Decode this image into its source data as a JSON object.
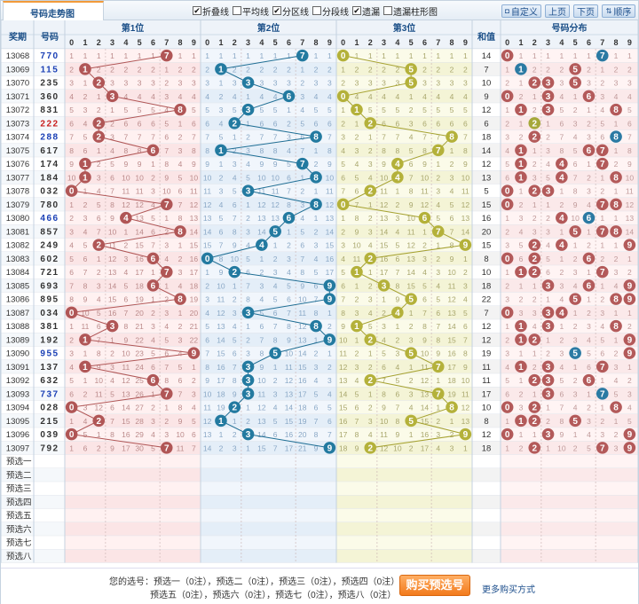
{
  "header": {
    "tab_title": "号码走势图",
    "options": [
      {
        "label": "折叠线",
        "checked": true
      },
      {
        "label": "平均线",
        "checked": false
      },
      {
        "label": "分区线",
        "checked": true
      },
      {
        "label": "分段线",
        "checked": false
      },
      {
        "label": "遗漏",
        "checked": true
      },
      {
        "label": "遗漏柱形图",
        "checked": false
      }
    ],
    "buttons": {
      "custom": "自定义",
      "prev": "上页",
      "next": "下页",
      "order": "顺序"
    }
  },
  "columns": {
    "period": "奖期",
    "number": "号码",
    "pos1": "第1位",
    "pos2": "第2位",
    "pos3": "第3位",
    "sum": "和值",
    "dist": "号码分布",
    "digits": [
      "0",
      "1",
      "2",
      "3",
      "4",
      "5",
      "6",
      "7",
      "8",
      "9"
    ]
  },
  "rows": [
    {
      "period": "13068",
      "number": "770",
      "digits": [
        7,
        7,
        0
      ],
      "sum": "14"
    },
    {
      "period": "13069",
      "number": "115",
      "digits": [
        1,
        1,
        5
      ],
      "sum": "7"
    },
    {
      "period": "13070",
      "number": "235",
      "digits": [
        2,
        3,
        5
      ],
      "sum": "10"
    },
    {
      "period": "13071",
      "number": "360",
      "digits": [
        3,
        6,
        0
      ],
      "sum": "9"
    },
    {
      "period": "13072",
      "number": "831",
      "digits": [
        8,
        3,
        1
      ],
      "sum": "12"
    },
    {
      "period": "13073",
      "number": "222",
      "digits": [
        2,
        2,
        2
      ],
      "sum": "6"
    },
    {
      "period": "13074",
      "number": "288",
      "digits": [
        2,
        8,
        8
      ],
      "sum": "18"
    },
    {
      "period": "13075",
      "number": "617",
      "digits": [
        6,
        1,
        7
      ],
      "sum": "14"
    },
    {
      "period": "13076",
      "number": "174",
      "digits": [
        1,
        7,
        4
      ],
      "sum": "12"
    },
    {
      "period": "13077",
      "number": "184",
      "digits": [
        1,
        8,
        4
      ],
      "sum": "13"
    },
    {
      "period": "13078",
      "number": "032",
      "digits": [
        0,
        3,
        2
      ],
      "sum": "5"
    },
    {
      "period": "13079",
      "number": "780",
      "digits": [
        7,
        8,
        0
      ],
      "sum": "15"
    },
    {
      "period": "13080",
      "number": "466",
      "digits": [
        4,
        6,
        6
      ],
      "sum": "16"
    },
    {
      "period": "13081",
      "number": "857",
      "digits": [
        8,
        5,
        7
      ],
      "sum": "20"
    },
    {
      "period": "13082",
      "number": "249",
      "digits": [
        2,
        4,
        9
      ],
      "sum": "15"
    },
    {
      "period": "13083",
      "number": "602",
      "digits": [
        6,
        0,
        2
      ],
      "sum": "8"
    },
    {
      "period": "13084",
      "number": "721",
      "digits": [
        7,
        2,
        1
      ],
      "sum": "10"
    },
    {
      "period": "13085",
      "number": "693",
      "digits": [
        6,
        9,
        3
      ],
      "sum": "18"
    },
    {
      "period": "13086",
      "number": "895",
      "digits": [
        8,
        9,
        5
      ],
      "sum": "22"
    },
    {
      "period": "13087",
      "number": "034",
      "digits": [
        0,
        3,
        4
      ],
      "sum": "7"
    },
    {
      "period": "13088",
      "number": "381",
      "digits": [
        3,
        8,
        1
      ],
      "sum": "12"
    },
    {
      "period": "13089",
      "number": "192",
      "digits": [
        1,
        9,
        2
      ],
      "sum": "12"
    },
    {
      "period": "13090",
      "number": "955",
      "digits": [
        9,
        5,
        5
      ],
      "sum": "19"
    },
    {
      "period": "13091",
      "number": "137",
      "digits": [
        1,
        3,
        7
      ],
      "sum": "11"
    },
    {
      "period": "13092",
      "number": "632",
      "digits": [
        6,
        3,
        2
      ],
      "sum": "11"
    },
    {
      "period": "13093",
      "number": "737",
      "digits": [
        7,
        3,
        7
      ],
      "sum": "17"
    },
    {
      "period": "13094",
      "number": "028",
      "digits": [
        0,
        2,
        8
      ],
      "sum": "10"
    },
    {
      "period": "13095",
      "number": "215",
      "digits": [
        2,
        1,
        5
      ],
      "sum": "8"
    },
    {
      "period": "13096",
      "number": "039",
      "digits": [
        0,
        3,
        9
      ],
      "sum": "12"
    },
    {
      "period": "13097",
      "number": "792",
      "digits": [
        7,
        9,
        2
      ],
      "sum": "18"
    }
  ],
  "preselect_rows": [
    "预选一",
    "预选二",
    "预选三",
    "预选四",
    "预选五",
    "预选六",
    "预选七",
    "预选八"
  ],
  "footer": {
    "line1": "您的选号：预选一（0注），预选二（0注），预选三（0注），预选四（0注）",
    "line2": "预选五（0注），预选六（0注），预选七（0注），预选八（0注）",
    "buy_button": "购买预选号",
    "more_link": "更多购买方式"
  },
  "colors": {
    "pos1_ball": "#b05656",
    "pos1_bg_odd": "#fff1f1",
    "pos1_bg_even": "#fbe5e6",
    "pos2_ball": "#237aa0",
    "pos2_bg_odd": "#f1f6fc",
    "pos2_bg_even": "#e4eef8",
    "pos3_ball": "#b4b13a",
    "pos3_bg_odd": "#fbfbe9",
    "pos3_bg_even": "#f4f4d6",
    "dist_ball_1": "#b35a5a",
    "dist_ball_2": "#a5a83a",
    "dist_ball_3": "#2b7aa3",
    "number_red": "#c81e1e",
    "number_blue": "#1a3fb5",
    "header_text": "#1b4f88"
  }
}
